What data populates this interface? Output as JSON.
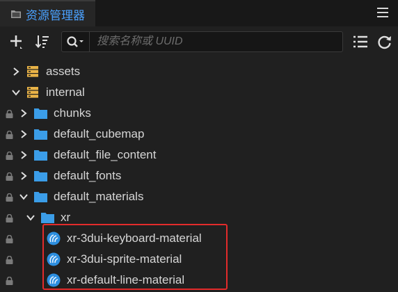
{
  "panel": {
    "title": "资源管理器",
    "menu_icon": "hamburger-menu-icon"
  },
  "toolbar": {
    "add_icon": "plus-icon",
    "sort_icon": "sort-icon",
    "search_icon": "search-icon",
    "search_placeholder": "搜索名称或 UUID",
    "list_icon": "list-view-icon",
    "refresh_icon": "refresh-icon"
  },
  "tree": {
    "items": [
      {
        "label": "assets",
        "type": "db",
        "expanded": false,
        "locked": false
      },
      {
        "label": "internal",
        "type": "db",
        "expanded": true,
        "locked": false
      },
      {
        "label": "chunks",
        "type": "folder",
        "expanded": false,
        "locked": true
      },
      {
        "label": "default_cubemap",
        "type": "folder",
        "expanded": false,
        "locked": true
      },
      {
        "label": "default_file_content",
        "type": "folder",
        "expanded": false,
        "locked": true
      },
      {
        "label": "default_fonts",
        "type": "folder",
        "expanded": false,
        "locked": true
      },
      {
        "label": "default_materials",
        "type": "folder",
        "expanded": true,
        "locked": true
      },
      {
        "label": "xr",
        "type": "folder",
        "expanded": true,
        "locked": true
      },
      {
        "label": "xr-3dui-keyboard-material",
        "type": "material",
        "locked": true
      },
      {
        "label": "xr-3dui-sprite-material",
        "type": "material",
        "locked": true
      },
      {
        "label": "xr-default-line-material",
        "type": "material",
        "locked": true
      }
    ]
  },
  "colors": {
    "accent": "#4aa1ff",
    "folder": "#3b9de8",
    "db": "#e9b347",
    "material": "#2d8fe0",
    "highlight": "#e32b2b"
  }
}
